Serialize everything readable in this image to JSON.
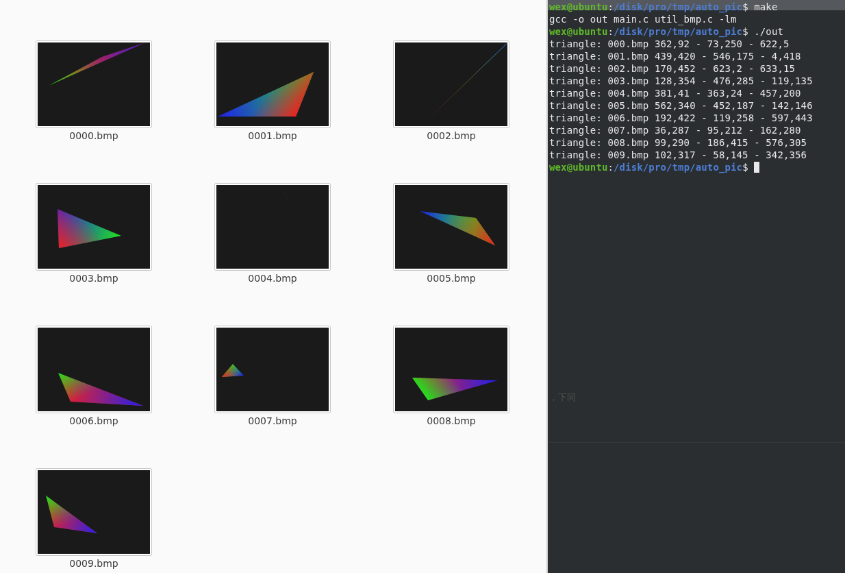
{
  "file_browser": {
    "files": [
      {
        "name": "0000.bmp"
      },
      {
        "name": "0001.bmp"
      },
      {
        "name": "0002.bmp"
      },
      {
        "name": "0003.bmp"
      },
      {
        "name": "0004.bmp"
      },
      {
        "name": "0005.bmp"
      },
      {
        "name": "0006.bmp"
      },
      {
        "name": "0007.bmp"
      },
      {
        "name": "0008.bmp"
      },
      {
        "name": "0009.bmp"
      }
    ]
  },
  "terminal": {
    "lines": [
      {
        "kind": "prompt",
        "user": "wex@ubuntu",
        "separator": ":",
        "path": "/disk/pro/tmp/auto_pic",
        "command": "$ make",
        "cursor": false
      },
      {
        "kind": "output",
        "text": "gcc -o out main.c util_bmp.c -lm"
      },
      {
        "kind": "prompt",
        "user": "wex@ubuntu",
        "separator": ":",
        "path": "/disk/pro/tmp/auto_pic",
        "command": "$ ./out",
        "cursor": false
      },
      {
        "kind": "output",
        "text": "triangle: 000.bmp 362,92 - 73,250 - 622,5"
      },
      {
        "kind": "output",
        "text": "triangle: 001.bmp 439,420 - 546,175 - 4,418"
      },
      {
        "kind": "output",
        "text": "triangle: 002.bmp 170,452 - 623,2 - 633,15"
      },
      {
        "kind": "output",
        "text": "triangle: 003.bmp 128,354 - 476,285 - 119,135"
      },
      {
        "kind": "output",
        "text": "triangle: 004.bmp 381,41 - 363,24 - 457,200"
      },
      {
        "kind": "output",
        "text": "triangle: 005.bmp 562,340 - 452,187 - 142,146"
      },
      {
        "kind": "output",
        "text": "triangle: 006.bmp 192,422 - 119,258 - 597,443"
      },
      {
        "kind": "output",
        "text": "triangle: 007.bmp 36,287 - 95,212 - 162,280"
      },
      {
        "kind": "output",
        "text": "triangle: 008.bmp 99,290 - 186,415 - 576,305"
      },
      {
        "kind": "output",
        "text": "triangle: 009.bmp 102,317 - 58,145 - 342,356"
      },
      {
        "kind": "prompt",
        "user": "wex@ubuntu",
        "separator": ":",
        "path": "/disk/pro/tmp/auto_pic",
        "command": "$ ",
        "cursor": true
      }
    ],
    "faint_text": "，下同"
  }
}
